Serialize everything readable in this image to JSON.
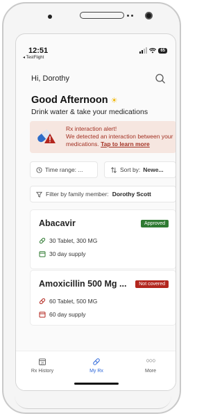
{
  "status": {
    "time": "12:51",
    "back_app": "◂ TestFlight",
    "battery": "65"
  },
  "header": {
    "greeting": "Hi, Dorothy"
  },
  "hero": {
    "title": "Good Afternoon",
    "subtitle": "Drink water & take your medications"
  },
  "alert": {
    "title": "Rx interaction alert!",
    "body": "We detected an interaction between your medications.",
    "link": "Tap to learn more"
  },
  "filters": {
    "time_range_label": "Time range: ...",
    "sort_label": "Sort by:",
    "sort_value": "Newe...",
    "family_label": "Filter by family member:",
    "family_value": "Dorothy Scott"
  },
  "prescriptions": [
    {
      "name": "Abacavir",
      "status": "Approved",
      "dose": "30 Tablet, 300 MG",
      "supply": "30 day supply"
    },
    {
      "name": "Amoxicillin 500 Mg ...",
      "status": "Not covered",
      "dose": "60 Tablet, 500 MG",
      "supply": "60 day supply"
    }
  ],
  "tabs": [
    {
      "label": "Rx History",
      "icon": "calendar-icon"
    },
    {
      "label": "My Rx",
      "icon": "pill-icon"
    },
    {
      "label": "More",
      "icon": "more-icon"
    }
  ],
  "colors": {
    "accent": "#2b66d9",
    "alert_bg": "#f6e6e0",
    "alert_text": "#a33224",
    "approved": "#2f7a32",
    "not_covered": "#b3261e"
  }
}
